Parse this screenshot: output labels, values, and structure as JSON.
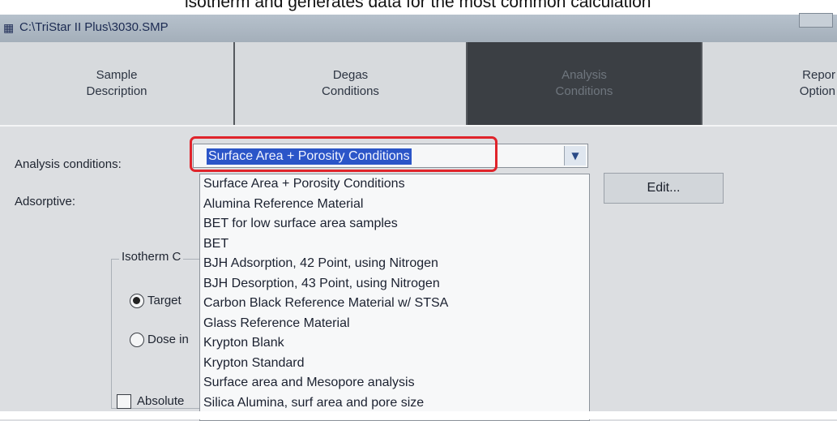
{
  "caption": "isotherm and generates data for the most common calculation",
  "window": {
    "title": "C:\\TriStar II Plus\\3030.SMP"
  },
  "tabs": [
    {
      "label": "Sample\nDescription"
    },
    {
      "label": "Degas\nConditions"
    },
    {
      "label": "Analysis\nConditions"
    },
    {
      "label": "Repor\nOption"
    }
  ],
  "form": {
    "analysis_conditions_label": "Analysis conditions:",
    "adsorptive_label": "Adsorptive:",
    "selected": "Surface Area + Porosity Conditions",
    "options": [
      "Surface Area + Porosity Conditions",
      "Alumina Reference Material",
      "BET for low surface area samples",
      "BET",
      "BJH Adsorption, 42 Point, using Nitrogen",
      "BJH Desorption, 43 Point, using Nitrogen",
      "Carbon Black Reference Material w/ STSA",
      "Glass Reference Material",
      "Krypton Blank",
      "Krypton Standard",
      "Surface area and Mesopore analysis",
      "Silica Alumina, surf area and pore size"
    ],
    "edit_label": "Edit...",
    "isotherm_group_label": "Isotherm C",
    "radio_target_label": "Target",
    "radio_dose_label": "Dose in",
    "checkbox_absolute_label": "Absolute"
  },
  "colors": {
    "highlight": "#e0242b",
    "selection": "#2b55c8",
    "active_tab": "#3b3f44"
  }
}
